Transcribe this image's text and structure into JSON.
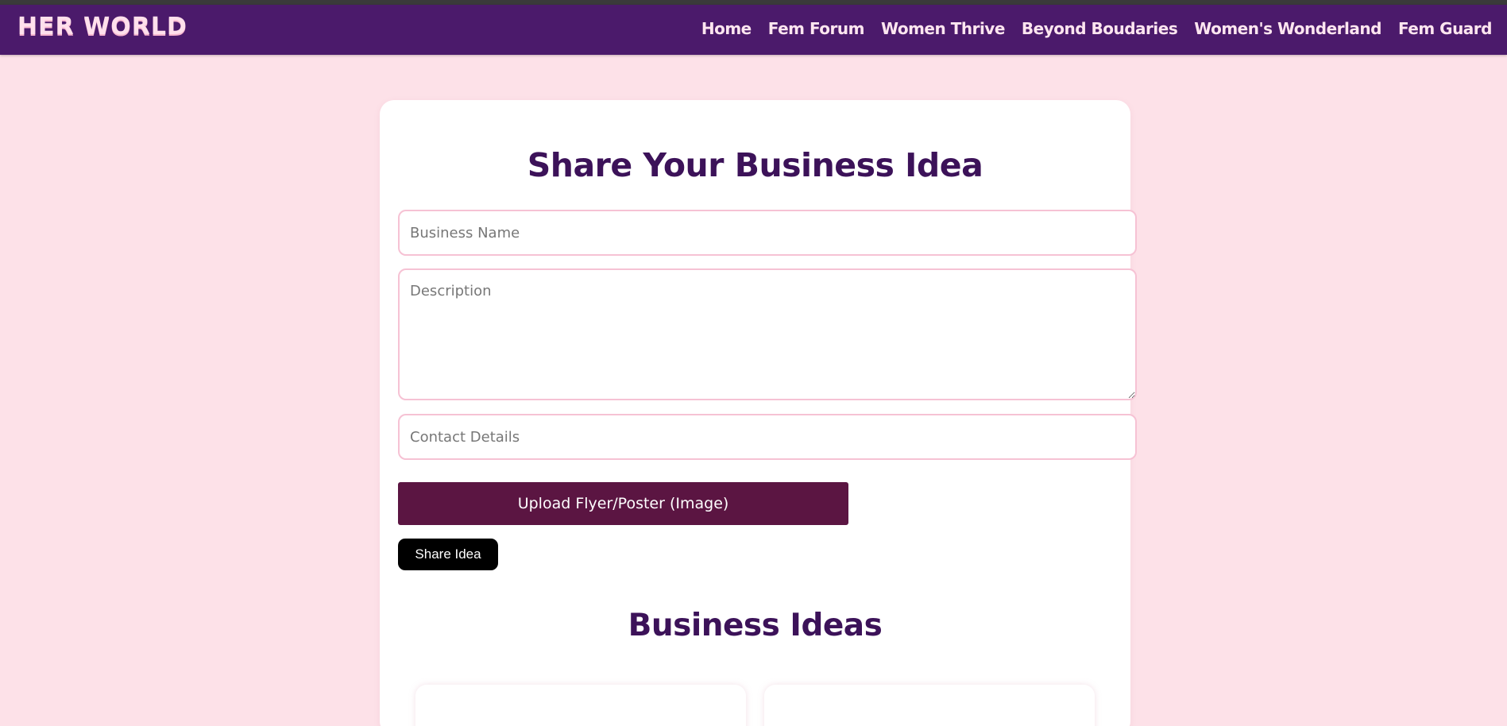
{
  "nav": {
    "logo": "HER WORLD",
    "links": [
      "Home",
      "Fem Forum",
      "Women Thrive",
      "Beyond Boudaries",
      "Women's Wonderland",
      "Fem Guard"
    ]
  },
  "form": {
    "title": "Share Your Business Idea",
    "business_name_placeholder": "Business Name",
    "description_placeholder": "Description",
    "contact_placeholder": "Contact Details",
    "upload_label": "Upload Flyer/Poster (Image)",
    "submit_label": "Share Idea"
  },
  "ideas": {
    "title": "Business Ideas"
  },
  "colors": {
    "background": "#fde1e8",
    "navbar": "#4b1a6b",
    "heading": "#3c1259",
    "upload_button": "#5b1542",
    "submit_button": "#000000"
  }
}
